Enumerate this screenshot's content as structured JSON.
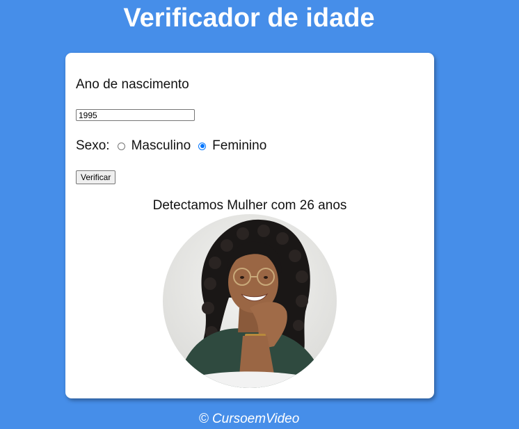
{
  "header": {
    "title": "Verificador de idade"
  },
  "form": {
    "birth_year_label": "Ano de nascimento",
    "birth_year_value": "1995",
    "sex_label": "Sexo:",
    "options": [
      {
        "label": "Masculino",
        "checked": false
      },
      {
        "label": "Feminino",
        "checked": true
      }
    ],
    "verify_button": "Verificar"
  },
  "result": {
    "text": "Detectamos Mulher com 26 anos",
    "photo_icon": "woman-portrait"
  },
  "footer": {
    "text": "© CursoemVideo"
  },
  "colors": {
    "background": "#468ee9",
    "card": "#ffffff",
    "radio_accent": "#0075ff"
  }
}
